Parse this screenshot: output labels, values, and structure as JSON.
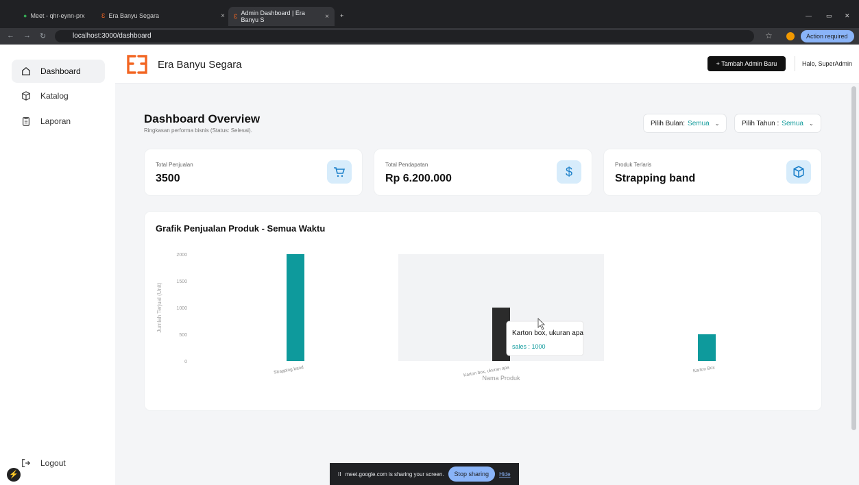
{
  "browser": {
    "tabs": [
      {
        "label": "Meet - qhr-eynn-prx"
      },
      {
        "label": "Era Banyu Segara"
      },
      {
        "label": "Admin Dashboard | Era Banyu S"
      }
    ],
    "url": "localhost:3000/dashboard",
    "action_required": "Action required",
    "profile_initial": "E"
  },
  "sidebar": {
    "items": [
      {
        "label": "Dashboard",
        "icon": "home-icon",
        "active": true
      },
      {
        "label": "Katalog",
        "icon": "box-icon"
      },
      {
        "label": "Laporan",
        "icon": "clipboard-icon"
      }
    ],
    "logout": "Logout"
  },
  "header": {
    "brand_name": "Era Banyu Segara",
    "add_admin": "Tambah Admin Baru",
    "greeting": "Halo, SuperAdmin"
  },
  "main": {
    "title": "Dashboard Overview",
    "subtitle": "Ringkasan performa bisnis (Status: Selesai).",
    "filters": {
      "month_label": "Pilih Bulan:",
      "month_value": "Semua",
      "year_label": "Pilih Tahun :",
      "year_value": "Semua"
    },
    "cards": [
      {
        "label": "Total Penjualan",
        "value": "3500",
        "icon": "cart-icon"
      },
      {
        "label": "Total Pendapatan",
        "value": "Rp 6.200.000",
        "icon": "dollar-icon"
      },
      {
        "label": "Produk Terlaris",
        "value": "Strapping band",
        "icon": "box-icon"
      }
    ]
  },
  "chart_data": {
    "type": "bar",
    "title": "Grafik Penjualan Produk - Semua Waktu",
    "xlabel": "Nama Produk",
    "ylabel": "Jumlah Terjual (Unit)",
    "categories": [
      "Strapping band",
      "Karton box, ukuran apa",
      "Karton Box"
    ],
    "values": [
      2000,
      1000,
      500
    ],
    "yticks": [
      0,
      500,
      1000,
      1500,
      2000
    ],
    "ylim": [
      0,
      2000
    ],
    "color": "#0e9a9c",
    "highlight_color": "#2b2b2b",
    "tooltip": {
      "title": "Karton box, ukuran apa",
      "series": "sales",
      "value": "1000"
    }
  },
  "share_banner": {
    "text": "meet.google.com is sharing your screen.",
    "stop": "Stop sharing",
    "hide": "Hide"
  }
}
